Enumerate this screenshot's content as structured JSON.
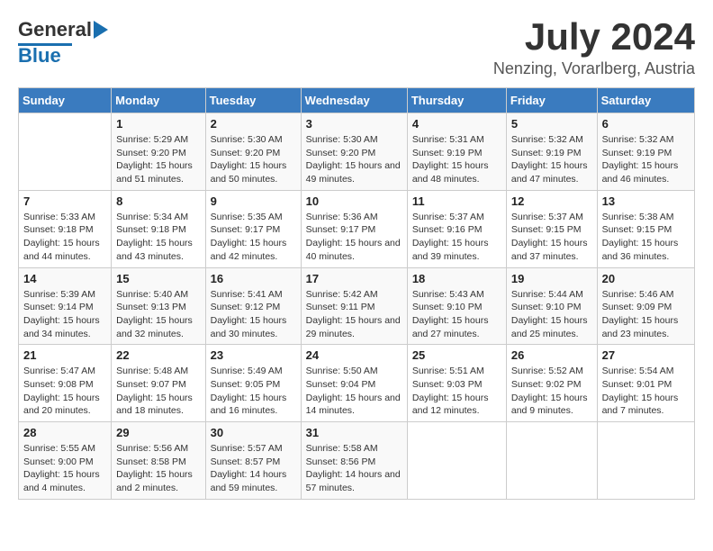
{
  "header": {
    "logo_line1": "General",
    "logo_line2": "Blue",
    "month": "July 2024",
    "location": "Nenzing, Vorarlberg, Austria"
  },
  "weekdays": [
    "Sunday",
    "Monday",
    "Tuesday",
    "Wednesday",
    "Thursday",
    "Friday",
    "Saturday"
  ],
  "weeks": [
    [
      {
        "day": "",
        "sunrise": "",
        "sunset": "",
        "daylight": ""
      },
      {
        "day": "1",
        "sunrise": "Sunrise: 5:29 AM",
        "sunset": "Sunset: 9:20 PM",
        "daylight": "Daylight: 15 hours and 51 minutes."
      },
      {
        "day": "2",
        "sunrise": "Sunrise: 5:30 AM",
        "sunset": "Sunset: 9:20 PM",
        "daylight": "Daylight: 15 hours and 50 minutes."
      },
      {
        "day": "3",
        "sunrise": "Sunrise: 5:30 AM",
        "sunset": "Sunset: 9:20 PM",
        "daylight": "Daylight: 15 hours and 49 minutes."
      },
      {
        "day": "4",
        "sunrise": "Sunrise: 5:31 AM",
        "sunset": "Sunset: 9:19 PM",
        "daylight": "Daylight: 15 hours and 48 minutes."
      },
      {
        "day": "5",
        "sunrise": "Sunrise: 5:32 AM",
        "sunset": "Sunset: 9:19 PM",
        "daylight": "Daylight: 15 hours and 47 minutes."
      },
      {
        "day": "6",
        "sunrise": "Sunrise: 5:32 AM",
        "sunset": "Sunset: 9:19 PM",
        "daylight": "Daylight: 15 hours and 46 minutes."
      }
    ],
    [
      {
        "day": "7",
        "sunrise": "Sunrise: 5:33 AM",
        "sunset": "Sunset: 9:18 PM",
        "daylight": "Daylight: 15 hours and 44 minutes."
      },
      {
        "day": "8",
        "sunrise": "Sunrise: 5:34 AM",
        "sunset": "Sunset: 9:18 PM",
        "daylight": "Daylight: 15 hours and 43 minutes."
      },
      {
        "day": "9",
        "sunrise": "Sunrise: 5:35 AM",
        "sunset": "Sunset: 9:17 PM",
        "daylight": "Daylight: 15 hours and 42 minutes."
      },
      {
        "day": "10",
        "sunrise": "Sunrise: 5:36 AM",
        "sunset": "Sunset: 9:17 PM",
        "daylight": "Daylight: 15 hours and 40 minutes."
      },
      {
        "day": "11",
        "sunrise": "Sunrise: 5:37 AM",
        "sunset": "Sunset: 9:16 PM",
        "daylight": "Daylight: 15 hours and 39 minutes."
      },
      {
        "day": "12",
        "sunrise": "Sunrise: 5:37 AM",
        "sunset": "Sunset: 9:15 PM",
        "daylight": "Daylight: 15 hours and 37 minutes."
      },
      {
        "day": "13",
        "sunrise": "Sunrise: 5:38 AM",
        "sunset": "Sunset: 9:15 PM",
        "daylight": "Daylight: 15 hours and 36 minutes."
      }
    ],
    [
      {
        "day": "14",
        "sunrise": "Sunrise: 5:39 AM",
        "sunset": "Sunset: 9:14 PM",
        "daylight": "Daylight: 15 hours and 34 minutes."
      },
      {
        "day": "15",
        "sunrise": "Sunrise: 5:40 AM",
        "sunset": "Sunset: 9:13 PM",
        "daylight": "Daylight: 15 hours and 32 minutes."
      },
      {
        "day": "16",
        "sunrise": "Sunrise: 5:41 AM",
        "sunset": "Sunset: 9:12 PM",
        "daylight": "Daylight: 15 hours and 30 minutes."
      },
      {
        "day": "17",
        "sunrise": "Sunrise: 5:42 AM",
        "sunset": "Sunset: 9:11 PM",
        "daylight": "Daylight: 15 hours and 29 minutes."
      },
      {
        "day": "18",
        "sunrise": "Sunrise: 5:43 AM",
        "sunset": "Sunset: 9:10 PM",
        "daylight": "Daylight: 15 hours and 27 minutes."
      },
      {
        "day": "19",
        "sunrise": "Sunrise: 5:44 AM",
        "sunset": "Sunset: 9:10 PM",
        "daylight": "Daylight: 15 hours and 25 minutes."
      },
      {
        "day": "20",
        "sunrise": "Sunrise: 5:46 AM",
        "sunset": "Sunset: 9:09 PM",
        "daylight": "Daylight: 15 hours and 23 minutes."
      }
    ],
    [
      {
        "day": "21",
        "sunrise": "Sunrise: 5:47 AM",
        "sunset": "Sunset: 9:08 PM",
        "daylight": "Daylight: 15 hours and 20 minutes."
      },
      {
        "day": "22",
        "sunrise": "Sunrise: 5:48 AM",
        "sunset": "Sunset: 9:07 PM",
        "daylight": "Daylight: 15 hours and 18 minutes."
      },
      {
        "day": "23",
        "sunrise": "Sunrise: 5:49 AM",
        "sunset": "Sunset: 9:05 PM",
        "daylight": "Daylight: 15 hours and 16 minutes."
      },
      {
        "day": "24",
        "sunrise": "Sunrise: 5:50 AM",
        "sunset": "Sunset: 9:04 PM",
        "daylight": "Daylight: 15 hours and 14 minutes."
      },
      {
        "day": "25",
        "sunrise": "Sunrise: 5:51 AM",
        "sunset": "Sunset: 9:03 PM",
        "daylight": "Daylight: 15 hours and 12 minutes."
      },
      {
        "day": "26",
        "sunrise": "Sunrise: 5:52 AM",
        "sunset": "Sunset: 9:02 PM",
        "daylight": "Daylight: 15 hours and 9 minutes."
      },
      {
        "day": "27",
        "sunrise": "Sunrise: 5:54 AM",
        "sunset": "Sunset: 9:01 PM",
        "daylight": "Daylight: 15 hours and 7 minutes."
      }
    ],
    [
      {
        "day": "28",
        "sunrise": "Sunrise: 5:55 AM",
        "sunset": "Sunset: 9:00 PM",
        "daylight": "Daylight: 15 hours and 4 minutes."
      },
      {
        "day": "29",
        "sunrise": "Sunrise: 5:56 AM",
        "sunset": "Sunset: 8:58 PM",
        "daylight": "Daylight: 15 hours and 2 minutes."
      },
      {
        "day": "30",
        "sunrise": "Sunrise: 5:57 AM",
        "sunset": "Sunset: 8:57 PM",
        "daylight": "Daylight: 14 hours and 59 minutes."
      },
      {
        "day": "31",
        "sunrise": "Sunrise: 5:58 AM",
        "sunset": "Sunset: 8:56 PM",
        "daylight": "Daylight: 14 hours and 57 minutes."
      },
      {
        "day": "",
        "sunrise": "",
        "sunset": "",
        "daylight": ""
      },
      {
        "day": "",
        "sunrise": "",
        "sunset": "",
        "daylight": ""
      },
      {
        "day": "",
        "sunrise": "",
        "sunset": "",
        "daylight": ""
      }
    ]
  ]
}
